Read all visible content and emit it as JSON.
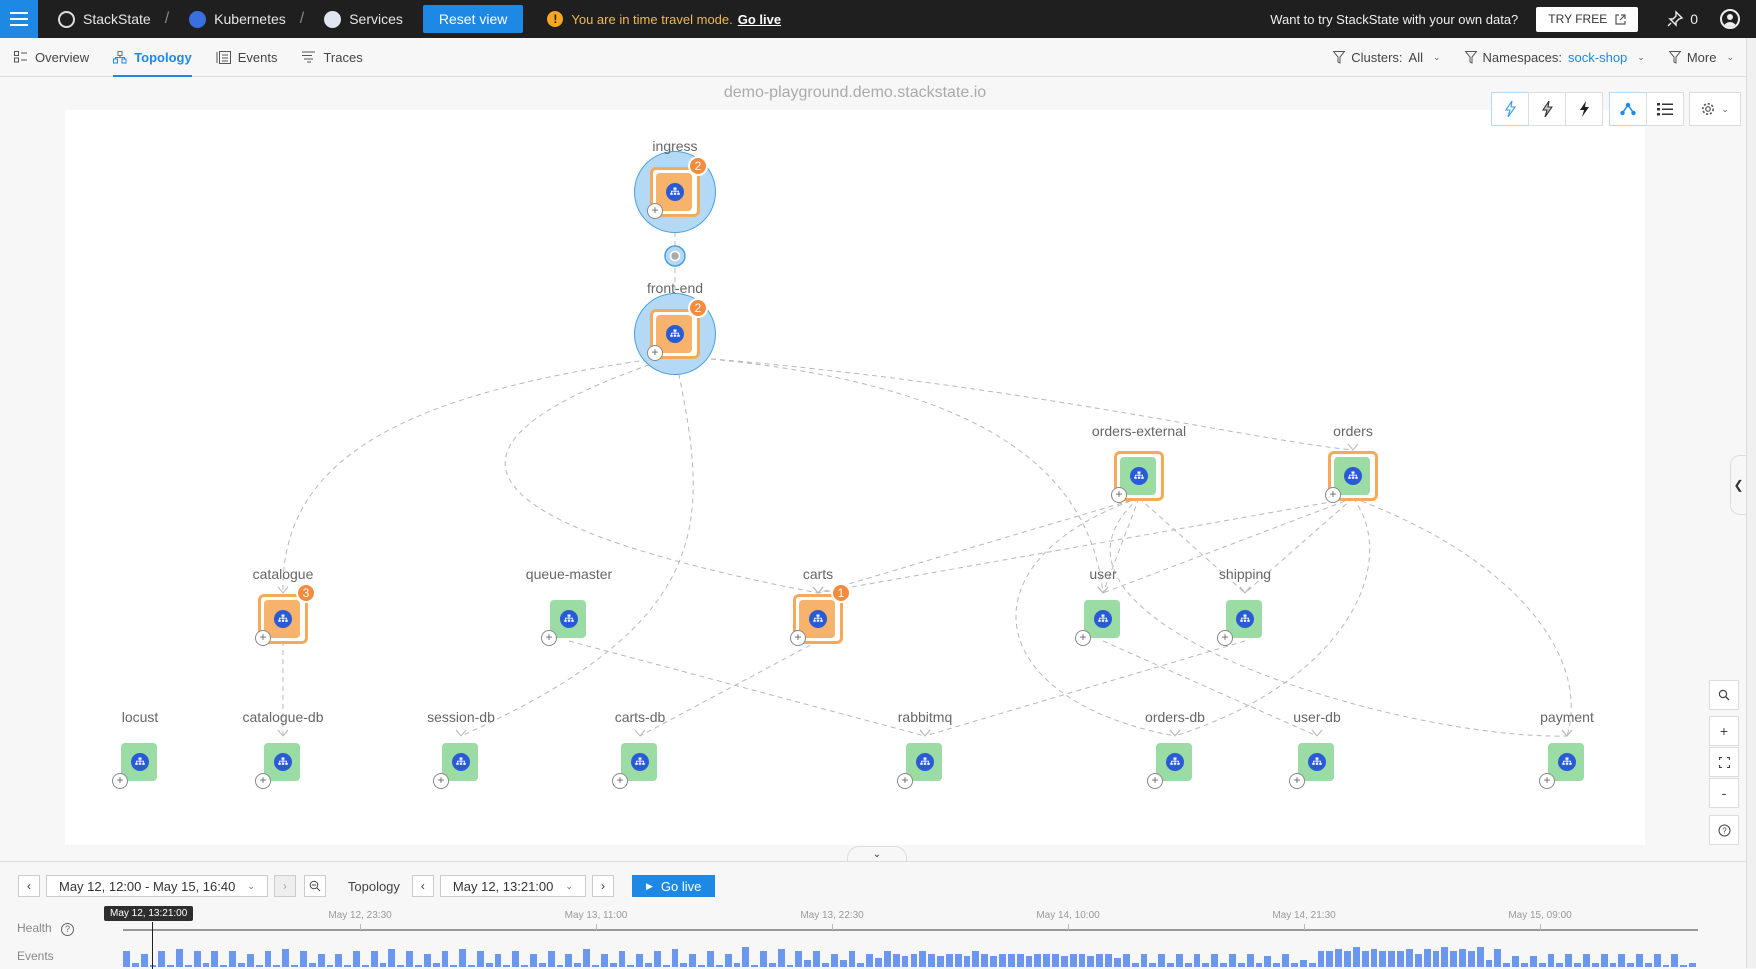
{
  "topbar": {
    "breadcrumbs": [
      {
        "label": "StackState",
        "icon": "stackstate-logo-icon"
      },
      {
        "label": "Kubernetes",
        "icon": "kubernetes-icon"
      },
      {
        "label": "Services",
        "icon": "services-icon"
      }
    ],
    "separator": "/",
    "reset_label": "Reset view",
    "time_travel_msg": "You are in time travel mode.",
    "go_live_link": "Go live",
    "promo_text": "Want to try StackState with your own data?",
    "try_free_label": "TRY FREE",
    "pin_count": "0"
  },
  "subnav": {
    "tabs": [
      {
        "label": "Overview",
        "icon": "overview-icon",
        "active": false
      },
      {
        "label": "Topology",
        "icon": "topology-icon",
        "active": true
      },
      {
        "label": "Events",
        "icon": "events-icon",
        "active": false
      },
      {
        "label": "Traces",
        "icon": "traces-icon",
        "active": false
      }
    ],
    "filters": {
      "clusters_label": "Clusters:",
      "clusters_value": "All",
      "namespaces_label": "Namespaces:",
      "namespaces_value": "sock-shop",
      "more_label": "More"
    }
  },
  "canvas": {
    "hostname": "demo-playground.demo.stackstate.io",
    "view_toolbar": [
      "show-all-events-icon",
      "show-some-events-icon",
      "show-critical-events-icon",
      "graph-view-icon",
      "list-view-icon",
      "settings-icon"
    ],
    "zoom_controls": [
      "search-icon",
      "zoom-in-icon",
      "fit-screen-icon",
      "zoom-out-icon",
      "help-icon"
    ]
  },
  "colors": {
    "accent": "#1e88e5",
    "healthy": "#9bdca4",
    "deviating": "#f7b26b",
    "badge": "#f58b3c",
    "warning_text": "#f2b94a",
    "event_bar": "#6b98ee"
  },
  "topology": {
    "nodes": [
      {
        "id": "ingress",
        "label": "ingress",
        "health": "deviating",
        "badge": "2",
        "halo": true
      },
      {
        "id": "front-end",
        "label": "front-end",
        "health": "deviating",
        "badge": "2",
        "halo": true
      },
      {
        "id": "orders-external",
        "label": "orders-external",
        "health": "healthy",
        "badge": null,
        "outlined": true
      },
      {
        "id": "orders",
        "label": "orders",
        "health": "healthy",
        "badge": null,
        "outlined": true
      },
      {
        "id": "catalogue",
        "label": "catalogue",
        "health": "deviating",
        "badge": "3"
      },
      {
        "id": "queue-master",
        "label": "queue-master",
        "health": "healthy",
        "badge": null
      },
      {
        "id": "carts",
        "label": "carts",
        "health": "deviating",
        "badge": "1"
      },
      {
        "id": "user",
        "label": "user",
        "health": "healthy",
        "badge": null
      },
      {
        "id": "shipping",
        "label": "shipping",
        "health": "healthy",
        "badge": null
      },
      {
        "id": "locust",
        "label": "locust",
        "health": "healthy",
        "badge": null
      },
      {
        "id": "catalogue-db",
        "label": "catalogue-db",
        "health": "healthy",
        "badge": null
      },
      {
        "id": "session-db",
        "label": "session-db",
        "health": "healthy",
        "badge": null
      },
      {
        "id": "carts-db",
        "label": "carts-db",
        "health": "healthy",
        "badge": null
      },
      {
        "id": "rabbitmq",
        "label": "rabbitmq",
        "health": "healthy",
        "badge": null
      },
      {
        "id": "orders-db",
        "label": "orders-db",
        "health": "healthy",
        "badge": null
      },
      {
        "id": "user-db",
        "label": "user-db",
        "health": "healthy",
        "badge": null
      },
      {
        "id": "payment",
        "label": "payment",
        "health": "healthy",
        "badge": null
      }
    ],
    "edges": [
      [
        "ingress",
        "front-end"
      ],
      [
        "front-end",
        "catalogue"
      ],
      [
        "front-end",
        "carts"
      ],
      [
        "front-end",
        "session-db"
      ],
      [
        "front-end",
        "user"
      ],
      [
        "front-end",
        "orders"
      ],
      [
        "catalogue",
        "catalogue-db"
      ],
      [
        "carts",
        "carts-db"
      ],
      [
        "queue-master",
        "rabbitmq"
      ],
      [
        "orders-external",
        "carts"
      ],
      [
        "orders-external",
        "user"
      ],
      [
        "orders-external",
        "shipping"
      ],
      [
        "orders-external",
        "orders-db"
      ],
      [
        "orders",
        "carts"
      ],
      [
        "orders",
        "user"
      ],
      [
        "orders",
        "shipping"
      ],
      [
        "orders",
        "payment"
      ],
      [
        "orders",
        "orders-db"
      ],
      [
        "shipping",
        "rabbitmq"
      ],
      [
        "user",
        "user-db"
      ],
      [
        "orders-external",
        "payment"
      ]
    ]
  },
  "timeline": {
    "range_label": "May 12, 12:00 - May 15, 16:40",
    "mode_label": "Topology",
    "time_label": "May 12, 13:21:00",
    "go_live_label": "Go live",
    "cursor_label": "May 12, 13:21:00",
    "ticks": [
      "May 12, 23:30",
      "May 13, 11:00",
      "May 13, 22:30",
      "May 14, 10:00",
      "May 14, 21:30",
      "May 15, 09:00"
    ],
    "health_label": "Health",
    "events_label": "Events",
    "events_histogram": [
      7,
      2,
      6,
      1,
      7,
      1,
      8,
      1,
      7,
      2,
      7,
      1,
      7,
      2,
      6,
      1,
      7,
      1,
      8,
      1,
      7,
      2,
      6,
      1,
      6,
      1,
      7,
      1,
      7,
      2,
      8,
      1,
      7,
      1,
      6,
      2,
      7,
      1,
      8,
      1,
      7,
      2,
      6,
      1,
      7,
      1,
      6,
      2,
      7,
      1,
      6,
      2,
      8,
      1,
      6,
      2,
      7,
      1,
      6,
      2,
      7,
      1,
      8,
      2,
      6,
      1,
      7,
      1,
      6,
      2,
      9,
      1,
      7,
      2,
      8,
      1,
      7,
      3,
      7,
      2,
      6,
      3,
      7,
      2,
      6,
      4,
      7,
      6,
      5,
      6,
      7,
      6,
      5,
      6,
      6,
      5,
      7,
      6,
      5,
      6,
      6,
      6,
      5,
      6,
      6,
      6,
      5,
      6,
      6,
      5,
      6,
      6,
      4,
      6,
      2,
      6,
      2,
      6,
      2,
      6,
      2,
      6,
      2,
      6,
      2,
      6,
      2,
      6,
      2,
      5,
      2,
      6,
      2,
      3,
      2,
      7,
      7,
      8,
      7,
      9,
      7,
      8,
      7,
      7,
      7,
      8,
      6,
      8,
      7,
      9,
      7,
      8,
      7,
      9,
      3,
      8,
      2,
      5,
      2,
      5,
      2,
      6,
      2,
      6,
      2,
      6,
      2,
      6,
      2,
      6,
      2,
      6,
      2,
      6,
      1,
      6,
      1,
      2
    ]
  }
}
